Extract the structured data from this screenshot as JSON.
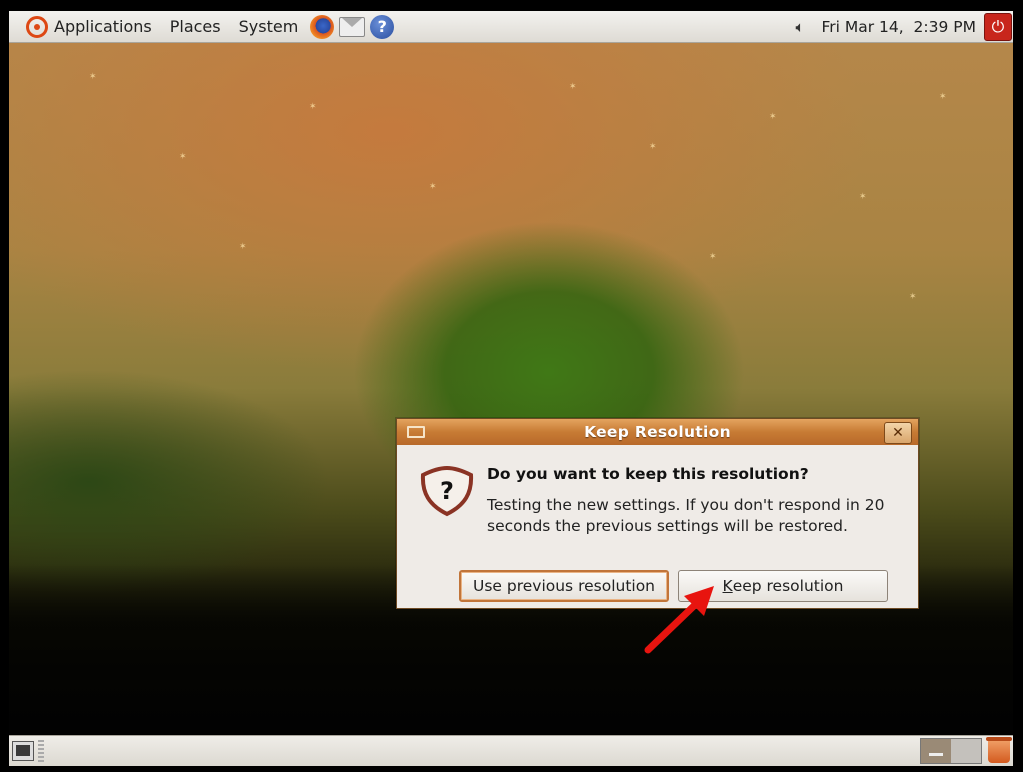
{
  "top_panel": {
    "menus": [
      "Applications",
      "Places",
      "System"
    ],
    "launchers": [
      "firefox-icon",
      "evolution-mail-icon",
      "help-icon"
    ],
    "clock": "Fri Mar 14,  2:39 PM"
  },
  "dialog": {
    "title": "Keep Resolution",
    "close_glyph": "✕",
    "icon_glyph": "?",
    "primary_text": "Do you want to keep this resolution?",
    "secondary_text": "Testing the new settings. If you don't respond in 20 seconds the previous settings will be restored.",
    "buttons": {
      "use_previous": "Use previous resolution",
      "keep_prefix": "K",
      "keep_rest": "eep resolution"
    }
  },
  "bottom_panel": {
    "workspaces": [
      "workspace-1",
      "workspace-2"
    ]
  },
  "colors": {
    "titlebar": "#c77b34",
    "arrow": "#e8140f",
    "power": "#c8261c"
  }
}
